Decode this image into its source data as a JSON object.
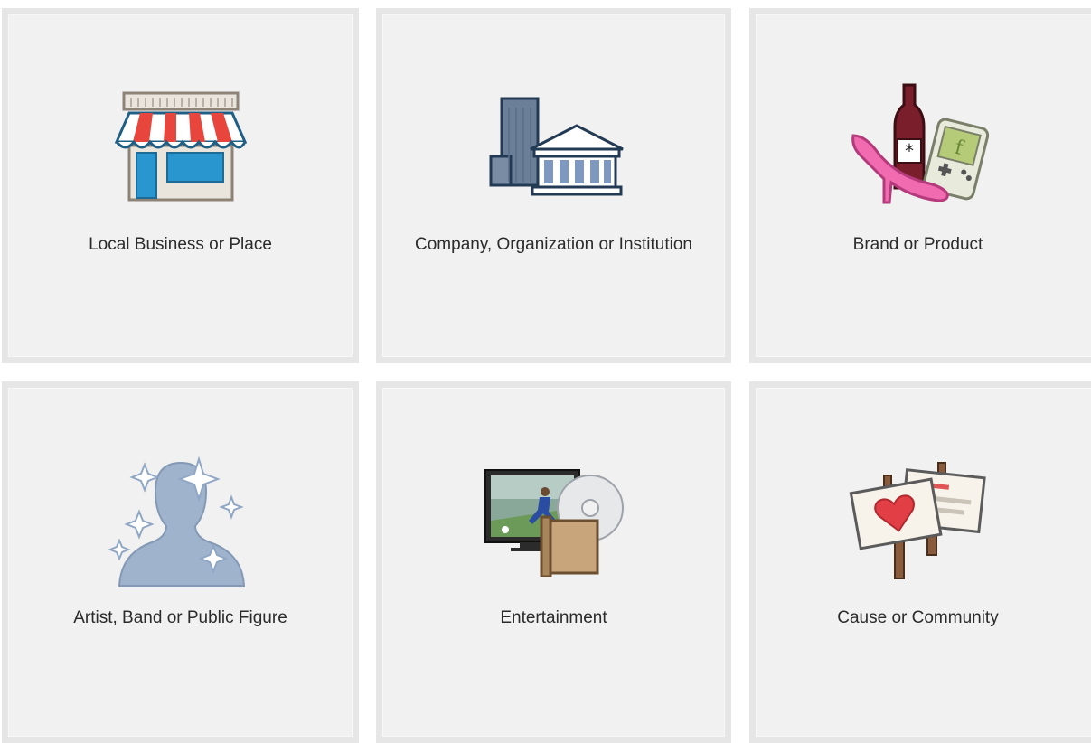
{
  "categories": [
    {
      "label": "Local Business or Place",
      "icon": "storefront-icon"
    },
    {
      "label": "Company, Organization or Institution",
      "icon": "buildings-icon"
    },
    {
      "label": "Brand or Product",
      "icon": "products-icon"
    },
    {
      "label": "Artist, Band or Public Figure",
      "icon": "public-figure-icon"
    },
    {
      "label": "Entertainment",
      "icon": "entertainment-icon"
    },
    {
      "label": "Cause or Community",
      "icon": "protest-signs-icon"
    }
  ],
  "colors": {
    "tile_background": "#f1f1f1",
    "tile_border": "#e6e6e6",
    "label_text": "#2b2b2b"
  }
}
